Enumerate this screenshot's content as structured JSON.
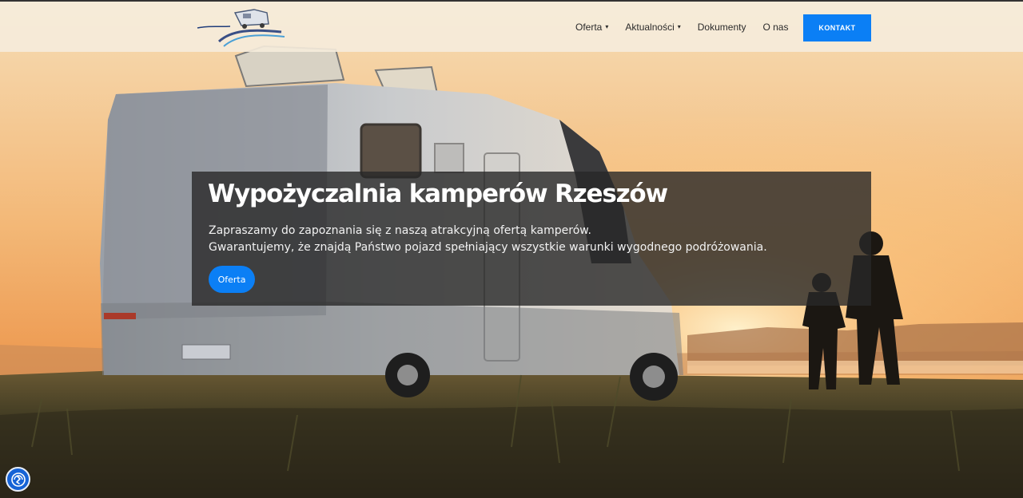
{
  "header": {
    "nav": [
      {
        "label": "Oferta",
        "dropdown": true
      },
      {
        "label": "Aktualności",
        "dropdown": true
      },
      {
        "label": "Dokumenty",
        "dropdown": false
      },
      {
        "label": "O nas",
        "dropdown": false
      }
    ],
    "contact_label": "KONTAKT"
  },
  "hero": {
    "title": "Wypożyczalnia kamperów Rzeszów",
    "lead_line1": "Zapraszamy do zapoznania się z naszą atrakcyjną ofertą kamperów.",
    "lead_line2": "Gwarantujemy, że znajdą Państwo pojazd spełniający wszystkie warunki wygodnego podróżowania.",
    "cta_label": "Oferta"
  },
  "icons": {
    "caret": "chevron-down-icon",
    "accessibility": "accessibility-icon",
    "logo": "speed-camp-logo"
  },
  "colors": {
    "accent": "#0b7ff5",
    "header_bg": "#f6ecdc",
    "caption_bg": "#282828"
  }
}
